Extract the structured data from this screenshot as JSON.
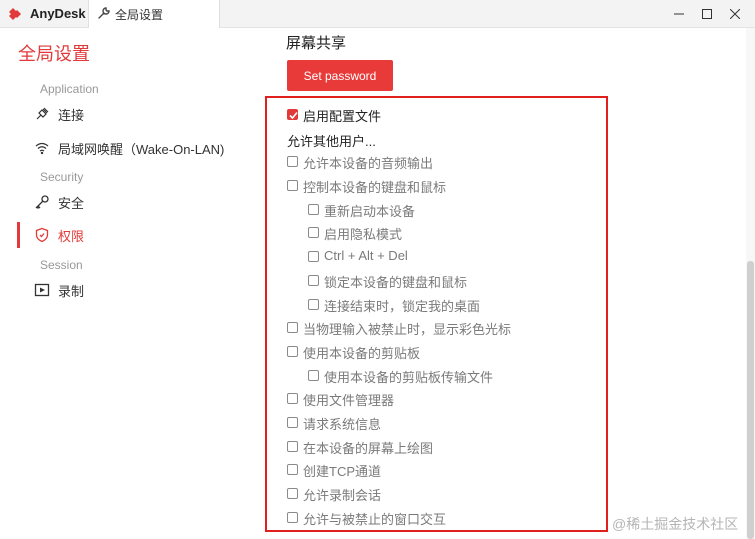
{
  "titlebar": {
    "app_name": "AnyDesk",
    "tab_label": "全局设置",
    "tab_icon": "wrench-icon",
    "controls": [
      "minimize-icon",
      "maximize-icon",
      "close-icon"
    ]
  },
  "sidebar": {
    "title": "全局设置",
    "sections": {
      "application": "Application",
      "security": "Security",
      "session": "Session"
    },
    "items": [
      {
        "label": "连接",
        "icon": "plug-icon"
      },
      {
        "label": "局域网唤醒（Wake-On-LAN)",
        "icon": "wifi-icon"
      },
      {
        "label": "安全",
        "icon": "key-icon"
      },
      {
        "label": "权限",
        "icon": "shield-icon",
        "active": true
      },
      {
        "label": "录制",
        "icon": "record-icon"
      }
    ]
  },
  "main": {
    "title": "屏幕共享",
    "set_password_label": "Set password",
    "profile": {
      "label": "启用配置文件",
      "checked": true
    },
    "allow_heading": "允许其他用户...",
    "permissions": [
      {
        "label": "允许本设备的音频输出",
        "checked": false
      },
      {
        "label": "控制本设备的键盘和鼠标",
        "checked": false
      },
      {
        "label": "重新启动本设备",
        "checked": false
      },
      {
        "label": "启用隐私模式",
        "checked": false
      },
      {
        "label": "Ctrl + Alt + Del",
        "checked": false
      },
      {
        "label": "锁定本设备的键盘和鼠标",
        "checked": false
      },
      {
        "label": "连接结束时，锁定我的桌面",
        "checked": false
      },
      {
        "label": "当物理输入被禁止时，显示彩色光标",
        "checked": false
      },
      {
        "label": "使用本设备的剪贴板",
        "checked": false
      },
      {
        "label": "使用本设备的剪贴板传输文件",
        "checked": false
      },
      {
        "label": "使用文件管理器",
        "checked": false
      },
      {
        "label": "请求系统信息",
        "checked": false
      },
      {
        "label": "在本设备的屏幕上绘图",
        "checked": false
      },
      {
        "label": "创建TCP通道",
        "checked": false
      },
      {
        "label": "允许录制会话",
        "checked": false
      },
      {
        "label": "允许与被禁止的窗口交互",
        "checked": false
      }
    ]
  },
  "colors": {
    "accent": "#e23a3a",
    "highlight_border": "#e01f1f"
  },
  "watermark": "@稀土掘金技术社区"
}
